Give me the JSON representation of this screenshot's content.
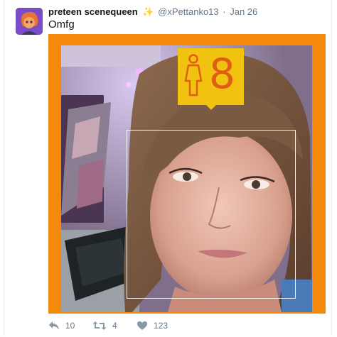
{
  "tweet": {
    "display_name": "preteen scenequeen",
    "emoji_icon": "sparkles-icon",
    "username": "@xPettanko13",
    "separator": "·",
    "date": "Jan 26",
    "text": "Omfg"
  },
  "media": {
    "frame_color": "#f5890b",
    "badge_color": "#f1c20f",
    "age_color": "#e25d14",
    "gender_icon": "female-icon",
    "age": "8"
  },
  "actions": {
    "reply_icon": "reply-icon",
    "reply_count": "10",
    "retweet_icon": "retweet-icon",
    "retweet_count": "4",
    "like_icon": "heart-icon",
    "like_count": "123"
  }
}
